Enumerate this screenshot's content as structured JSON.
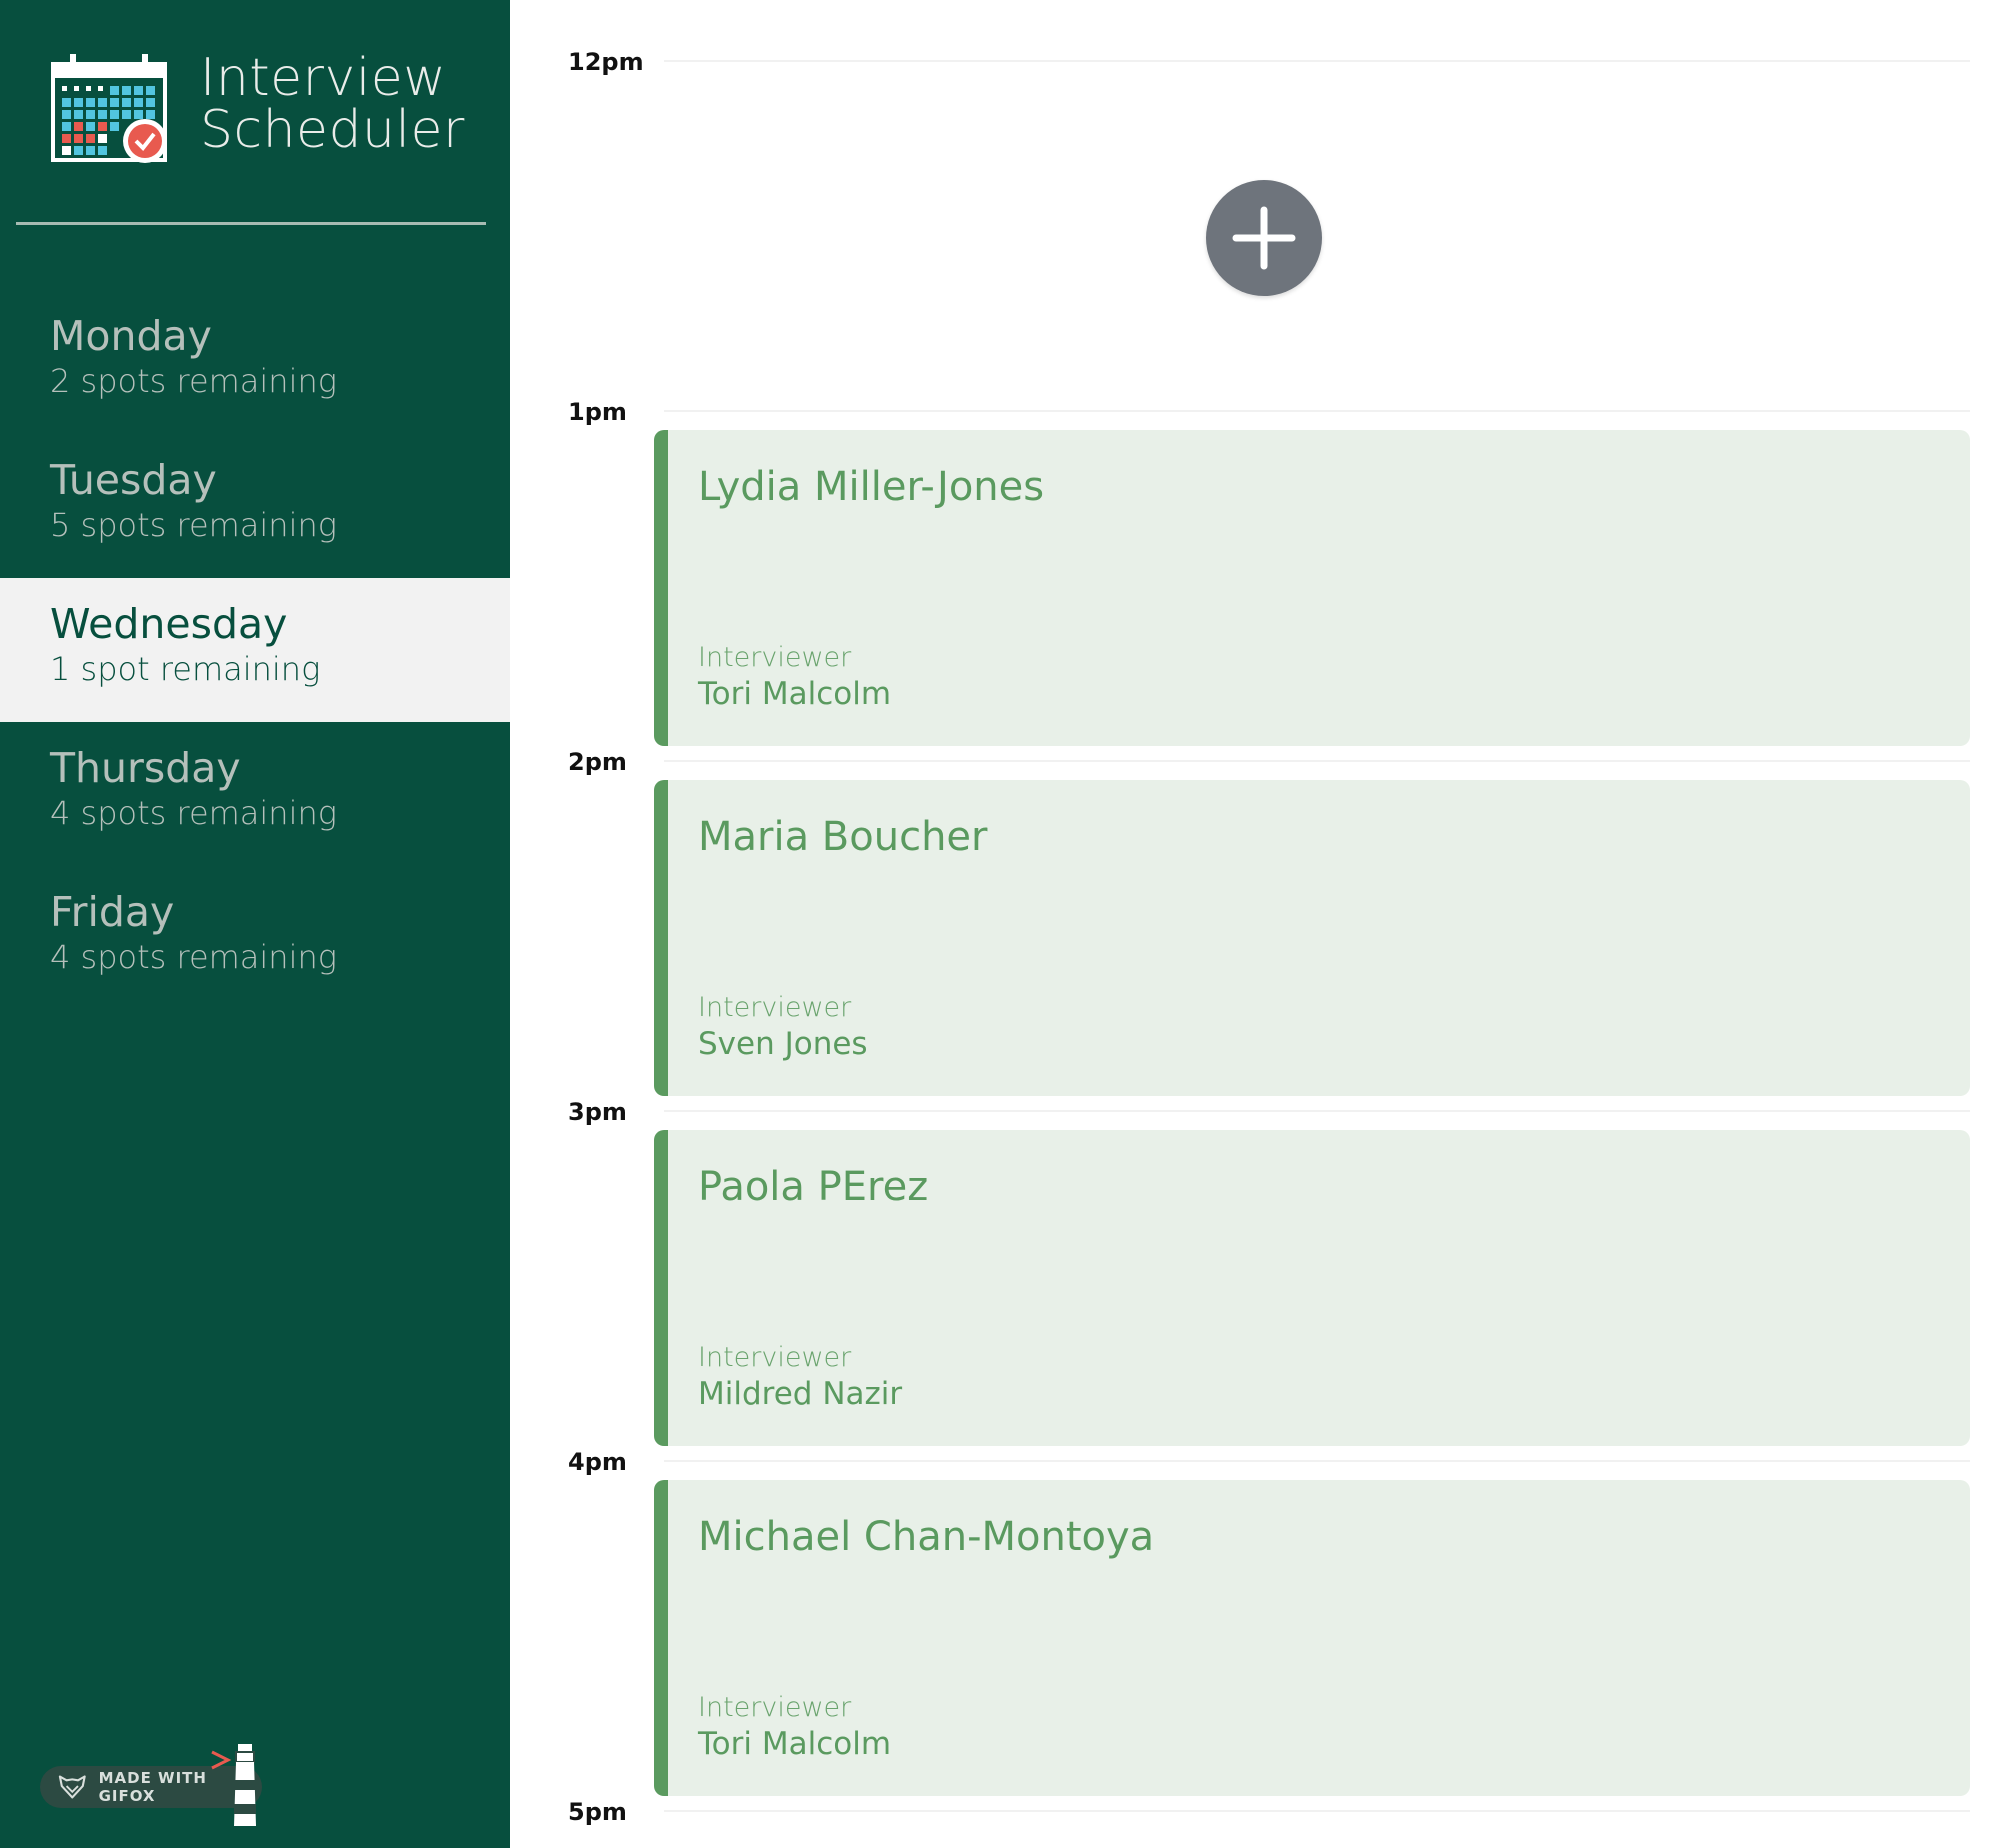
{
  "app": {
    "title_line1": "Interview",
    "title_line2": "Scheduler"
  },
  "colors": {
    "sidebar_bg": "#074f3e",
    "selected_bg": "#f2f2f2",
    "appointment_bg": "#e8f0e8",
    "appointment_accent": "#5a9a5f",
    "add_button": "#6e747c"
  },
  "days": [
    {
      "name": "Monday",
      "spots": "2 spots remaining"
    },
    {
      "name": "Tuesday",
      "spots": "5 spots remaining"
    },
    {
      "name": "Wednesday",
      "spots": "1 spot remaining",
      "selected": true
    },
    {
      "name": "Thursday",
      "spots": "4 spots remaining"
    },
    {
      "name": "Friday",
      "spots": "4 spots remaining"
    }
  ],
  "hours": [
    "12pm",
    "1pm",
    "2pm",
    "3pm",
    "4pm",
    "5pm"
  ],
  "appointments": [
    {
      "student": "Lydia Miller-Jones",
      "interviewer_label": "Interviewer",
      "interviewer": "Tori Malcolm"
    },
    {
      "student": "Maria Boucher",
      "interviewer_label": "Interviewer",
      "interviewer": "Sven Jones"
    },
    {
      "student": "Paola PErez",
      "interviewer_label": "Interviewer",
      "interviewer": "Mildred Nazir"
    },
    {
      "student": "Michael Chan-Montoya",
      "interviewer_label": "Interviewer",
      "interviewer": "Tori Malcolm"
    }
  ],
  "watermark": {
    "text": "MADE WITH GIFOX"
  },
  "icons": {
    "logo": "calendar-check-icon",
    "add": "plus-icon"
  }
}
